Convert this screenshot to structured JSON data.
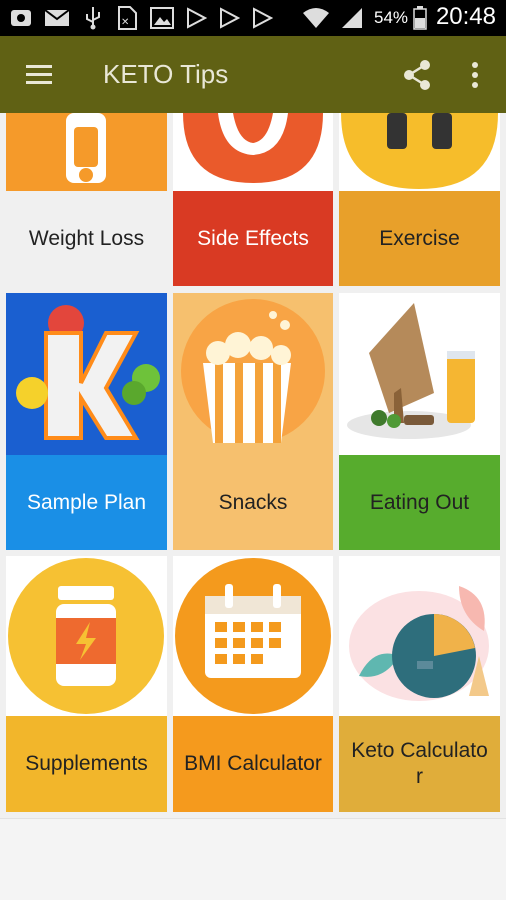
{
  "status_bar": {
    "battery_pct": "54%",
    "time": "20:48",
    "icons": [
      "message-icon",
      "mail-icon",
      "usb-icon",
      "sim-icon",
      "image-icon",
      "play-store-icon",
      "play-store-icon",
      "play-store-icon",
      "wifi-icon",
      "signal-icon",
      "battery-icon"
    ]
  },
  "app_bar": {
    "title": "KETO Tips",
    "menu_icon": "hamburger-menu-icon",
    "share_icon": "share-icon",
    "more_icon": "more-vert-icon"
  },
  "tiles": [
    {
      "label": "Weight Loss",
      "icon": "weight-loss-icon",
      "label_color": "#f08a1a"
    },
    {
      "label": "Side Effects",
      "icon": "side-effects-icon",
      "label_color": "#d93a23"
    },
    {
      "label": "Exercise",
      "icon": "exercise-icon",
      "label_color": "#e8a02a"
    },
    {
      "label": "Sample Plan",
      "icon": "keto-k-icon",
      "label_color": "#1a8fe6"
    },
    {
      "label": "Snacks",
      "icon": "popcorn-icon",
      "label_color": "#f6c06e"
    },
    {
      "label": "Eating Out",
      "icon": "table-sign-icon",
      "label_color": "#57ac2d"
    },
    {
      "label": "Supplements",
      "icon": "supplement-jar-icon",
      "label_color": "#f2b62b"
    },
    {
      "label": "BMI Calculator",
      "icon": "calendar-icon",
      "label_color": "#f59a1d"
    },
    {
      "label": "Keto Calculator",
      "icon": "pie-chart-icon",
      "label_color": "#e0ad3a"
    }
  ],
  "colors": {
    "app_bar": "#606114",
    "title_text": "#e9e7d6"
  }
}
